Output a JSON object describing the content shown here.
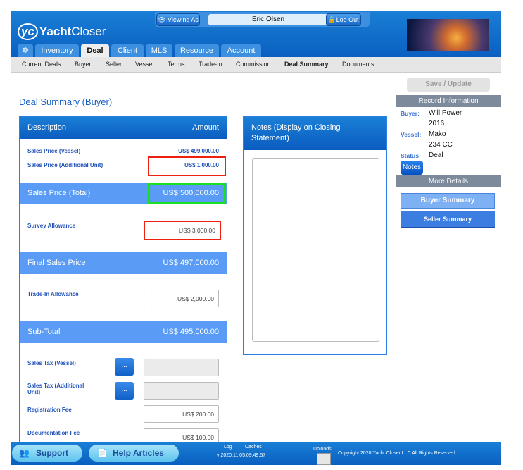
{
  "header": {
    "logo": "YachtCloser",
    "viewing_as_label": "Viewing As",
    "viewing_as_user": "Eric Olsen",
    "logout_label": "Log Out"
  },
  "tabs": [
    {
      "label": "Inventory"
    },
    {
      "label": "Deal",
      "active": true
    },
    {
      "label": "Client"
    },
    {
      "label": "MLS"
    },
    {
      "label": "Resource"
    },
    {
      "label": "Account"
    }
  ],
  "subnav": [
    "Current Deals",
    "Buyer",
    "Seller",
    "Vessel",
    "Terms",
    "Trade-In",
    "Commission",
    "Deal Summary",
    "Documents"
  ],
  "subnav_active": "Deal Summary",
  "page_title": "Deal Summary (Buyer)",
  "summary": {
    "col_description": "Description",
    "col_amount": "Amount",
    "sales_vessel": {
      "label": "Sales Price (Vessel)",
      "value": "US$ 499,000.00"
    },
    "sales_additional": {
      "label": "Sales Price (Additional Unit)",
      "value": "US$ 1,000.00"
    },
    "sales_total": {
      "label": "Sales Price (Total)",
      "value": "US$ 500,000.00"
    },
    "survey": {
      "label": "Survey Allowance",
      "value": "US$ 3,000.00"
    },
    "final": {
      "label": "Final Sales Price",
      "value": "US$ 497,000.00"
    },
    "tradein": {
      "label": "Trade-In Allowance",
      "value": "US$ 2,000.00"
    },
    "subtotal": {
      "label": "Sub-Total",
      "value": "US$ 495,000.00"
    },
    "tax_vessel": {
      "label": "Sales Tax (Vessel)",
      "value": ""
    },
    "tax_additional": {
      "label": "Sales Tax (Additional Unit)",
      "value": ""
    },
    "registration": {
      "label": "Registration Fee",
      "value": "US$ 200.00"
    },
    "documentation": {
      "label": "Documentation Fee",
      "value": "US$ 100.00"
    },
    "more_button": "..."
  },
  "notes": {
    "title": "Notes (Display on Closing Statement)",
    "value": ""
  },
  "sidebar": {
    "save_label": "Save / Update",
    "record_info": "Record Information",
    "buyer_label": "Buyer:",
    "buyer_name": "Will Power",
    "year": "2016",
    "vessel_label": "Vessel:",
    "vessel_make": "Mako",
    "vessel_model": "234 CC",
    "status_label": "Status:",
    "status": "Deal",
    "notes_button": "Notes",
    "more_details": "More Details",
    "buyer_summary": "Buyer Summary",
    "seller_summary": "Seller Summary"
  },
  "footer": {
    "support": "Support",
    "help": "Help Articles",
    "log": "Log",
    "caches": "Caches",
    "version": "v:2020.11.05.09.49.57",
    "uploads": "Uploads",
    "copyright": "Copyright 2020 Yacht Closer LLC All Rights Reserved"
  },
  "colors": {
    "brand_blue": "#0a5fc0",
    "band_blue": "#5a9cf5",
    "highlight_red": "#f02010",
    "highlight_green": "#18e020"
  }
}
